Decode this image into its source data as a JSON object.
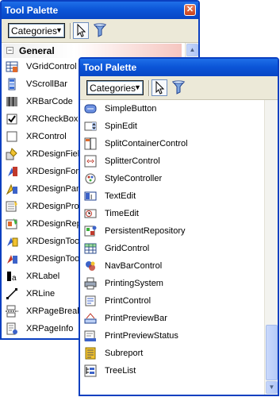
{
  "back_window": {
    "title": "Tool Palette",
    "category_select": "Categories",
    "group": {
      "label": "General",
      "toggle": "−"
    },
    "items": [
      {
        "label": "VGridControl",
        "icon": "vgrid-icon"
      },
      {
        "label": "VScrollBar",
        "icon": "vscrollbar-icon"
      },
      {
        "label": "XRBarCode",
        "icon": "barcode-icon"
      },
      {
        "label": "XRCheckBox",
        "icon": "checkbox-icon"
      },
      {
        "label": "XRControl",
        "icon": "control-icon"
      },
      {
        "label": "XRDesignField",
        "icon": "design-field-icon"
      },
      {
        "label": "XRDesignForm",
        "icon": "design-form-icon"
      },
      {
        "label": "XRDesignPanel",
        "icon": "design-panel-icon"
      },
      {
        "label": "XRDesignProp",
        "icon": "design-prop-icon"
      },
      {
        "label": "XRDesignRepo",
        "icon": "design-repo-icon"
      },
      {
        "label": "XRDesignToo",
        "icon": "design-tool-icon"
      },
      {
        "label": "XRDesignToo",
        "icon": "design-tool2-icon"
      },
      {
        "label": "XRLabel",
        "icon": "label-icon"
      },
      {
        "label": "XRLine",
        "icon": "line-icon"
      },
      {
        "label": "XRPageBreak",
        "icon": "page-break-icon"
      },
      {
        "label": "XRPageInfo",
        "icon": "page-info-icon"
      }
    ]
  },
  "front_window": {
    "title": "Tool Palette",
    "category_select": "Categories",
    "items": [
      {
        "label": "SimpleButton",
        "icon": "button-icon"
      },
      {
        "label": "SpinEdit",
        "icon": "spin-edit-icon"
      },
      {
        "label": "SplitContainerControl",
        "icon": "split-container-icon"
      },
      {
        "label": "SplitterControl",
        "icon": "splitter-icon"
      },
      {
        "label": "StyleController",
        "icon": "style-icon"
      },
      {
        "label": "TextEdit",
        "icon": "text-edit-icon"
      },
      {
        "label": "TimeEdit",
        "icon": "time-edit-icon"
      },
      {
        "label": "PersistentRepository",
        "icon": "repository-icon"
      },
      {
        "label": "GridControl",
        "icon": "grid-icon"
      },
      {
        "label": "NavBarControl",
        "icon": "navbar-icon"
      },
      {
        "label": "PrintingSystem",
        "icon": "printer-icon"
      },
      {
        "label": "PrintControl",
        "icon": "print-control-icon"
      },
      {
        "label": "PrintPreviewBar",
        "icon": "preview-bar-icon"
      },
      {
        "label": "PrintPreviewStatus",
        "icon": "preview-status-icon"
      },
      {
        "label": "Subreport",
        "icon": "subreport-icon"
      },
      {
        "label": "TreeList",
        "icon": "tree-list-icon"
      }
    ]
  },
  "glyphs": {
    "close": "✕",
    "dropdown_arrow": "▼",
    "scroll_up": "▲",
    "scroll_down": "▼"
  }
}
